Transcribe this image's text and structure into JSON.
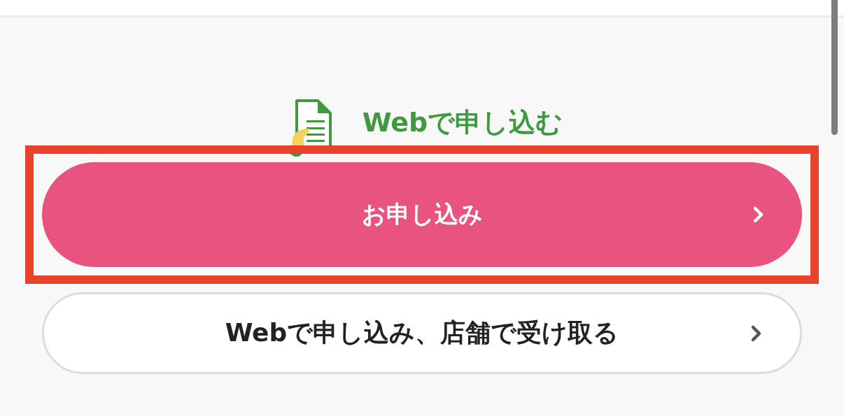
{
  "section": {
    "title": "Webで申し込む"
  },
  "buttons": [
    {
      "label": "お申し込み",
      "kind": "primary",
      "highlighted": true
    },
    {
      "label": "Webで申し込み、店舗で受け取る",
      "kind": "secondary",
      "highlighted": false
    }
  ]
}
